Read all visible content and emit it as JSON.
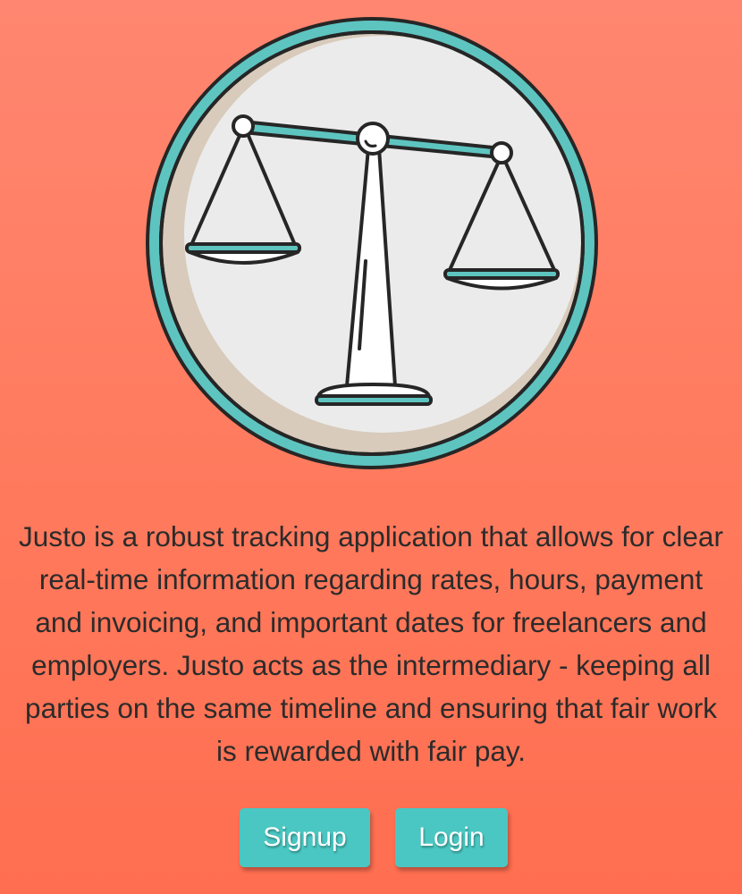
{
  "logo": {
    "icon": "balance-scale-icon",
    "colors": {
      "ring": "#5ec4c0",
      "face": "#ebebeb",
      "shadow": "#d8cbbb",
      "outline": "#262626",
      "white": "#ffffff"
    }
  },
  "description": "Justo is a robust tracking application that allows for clear real-time information regarding rates, hours, payment and invoicing, and important dates for freelancers and employers. Justo acts as the intermediary - keeping all parties on the same timeline and ensuring that fair work is rewarded with fair pay.",
  "actions": {
    "signup_label": "Signup",
    "login_label": "Login"
  },
  "colors": {
    "background": "#ff7a5d",
    "button": "#4ac7c2",
    "button_text": "#ffffff",
    "text": "#2b2b2b"
  }
}
